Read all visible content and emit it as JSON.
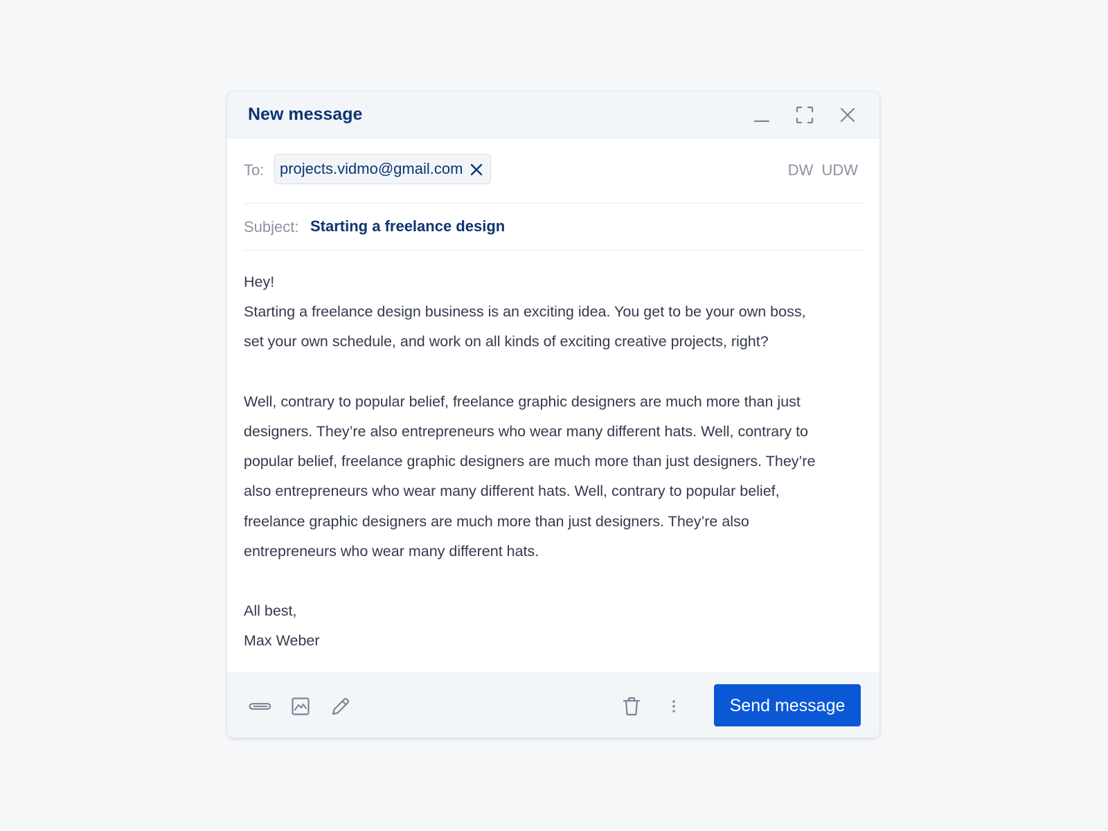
{
  "window": {
    "title": "New message",
    "controls": {
      "minimize": "minimize-icon",
      "maximize": "maximize-icon",
      "close": "close-icon"
    }
  },
  "to": {
    "label": "To:",
    "recipients": [
      {
        "email": "projects.vidmo@gmail.com"
      }
    ],
    "extra_links": [
      "DW",
      "UDW"
    ]
  },
  "subject": {
    "label": "Subject:",
    "value": "Starting a freelance design"
  },
  "body": {
    "lines": [
      "Hey!",
      "Starting a freelance design business is an exciting idea. You get to be your own boss,",
      "set your own schedule, and work on all kinds of exciting creative projects, right?",
      "",
      "Well, contrary to popular belief, freelance graphic designers are much more than just",
      "designers. They’re also entrepreneurs who wear many different hats. Well, contrary to",
      "popular belief, freelance graphic designers are much more than just designers. They’re",
      "also entrepreneurs who wear many different hats. Well, contrary to popular belief,",
      "freelance graphic designers are much more than just designers. They’re also",
      "entrepreneurs who wear many different hats.",
      "",
      "All best,",
      "Max Weber"
    ]
  },
  "footer": {
    "tools": [
      "paperclip-icon",
      "image-icon",
      "pencil-icon"
    ],
    "actions": [
      "trash-icon",
      "more-vertical-icon"
    ],
    "send_label": "Send message"
  },
  "colors": {
    "accent": "#0a58d6",
    "title": "#0d3572",
    "muted": "#8b93a1",
    "body": "#333a4d",
    "panel": "#f3f6f9"
  }
}
